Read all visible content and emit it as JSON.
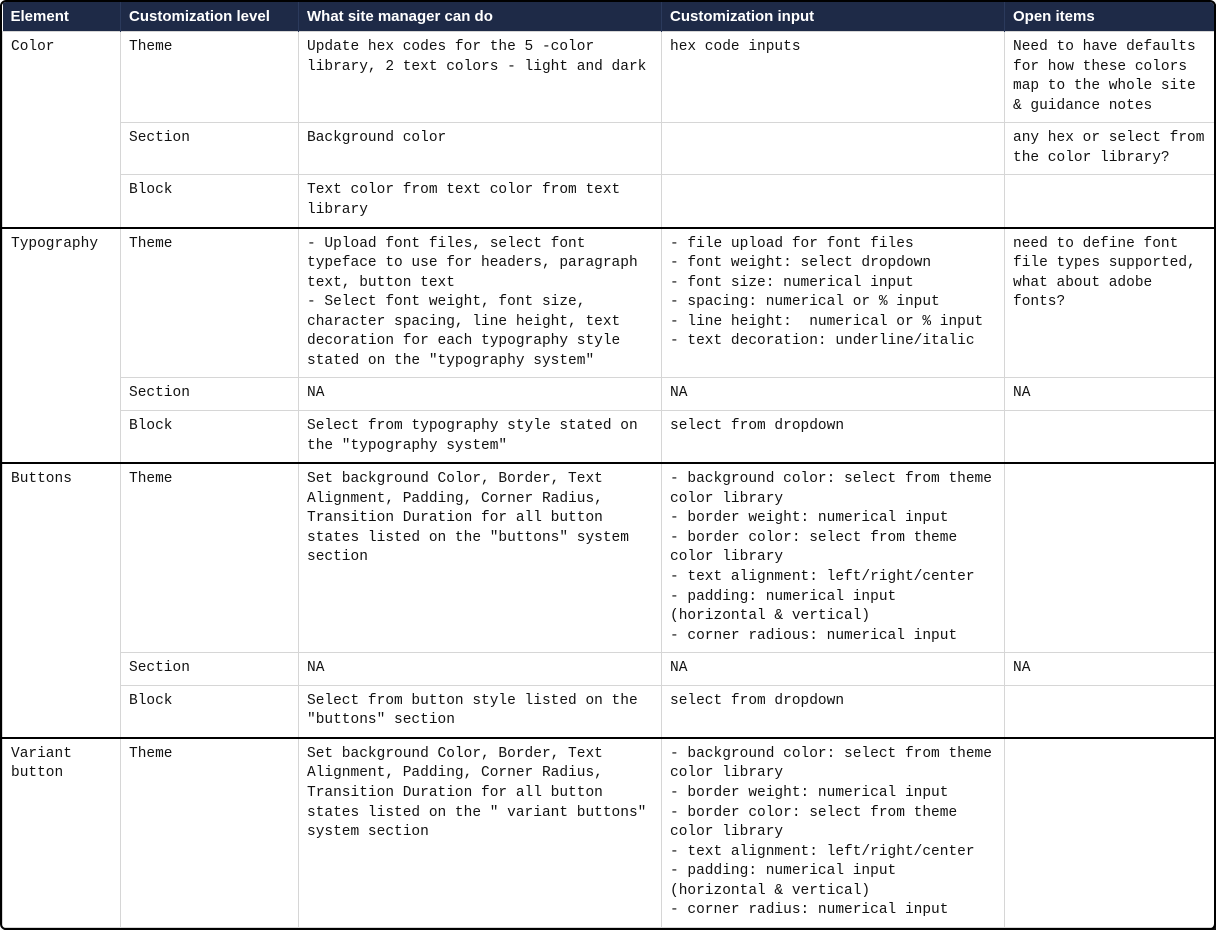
{
  "columns": [
    "Element",
    "Customization level",
    "What site manager can do",
    "Customization input",
    "Open items"
  ],
  "groups": [
    {
      "element": "Color",
      "rows": [
        {
          "level": "Theme",
          "what": "Update hex codes for the 5 -color library, 2 text colors - light and dark",
          "input": "hex code inputs",
          "open": "Need to have defaults for how these colors map to the whole site & guidance notes"
        },
        {
          "level": "Section",
          "what": "Background color",
          "input": "",
          "open": "any hex or select from the color library?"
        },
        {
          "level": "Block",
          "what": "Text color from text color from text library",
          "input": "",
          "open": ""
        }
      ]
    },
    {
      "element": "Typography",
      "rows": [
        {
          "level": "Theme",
          "what": "- Upload font files, select font typeface to use for headers, paragraph text, button text\n- Select font weight, font size, character spacing, line height, text decoration for each typography style stated on the \"typography system\"",
          "input": "- file upload for font files\n- font weight: select dropdown\n- font size: numerical input\n- spacing: numerical or % input\n- line height:  numerical or % input\n- text decoration: underline/italic",
          "open": "need to define font file types supported, what about adobe fonts?"
        },
        {
          "level": "Section",
          "what": "NA",
          "input": "NA",
          "open": "NA"
        },
        {
          "level": "Block",
          "what": "Select from typography style stated on the \"typography system\"",
          "input": "select from dropdown",
          "open": ""
        }
      ]
    },
    {
      "element": "Buttons",
      "rows": [
        {
          "level": "Theme",
          "what": "Set background Color, Border, Text Alignment, Padding, Corner Radius, Transition Duration for all button states listed on the \"buttons\" system section",
          "input": "- background color: select from theme color library\n- border weight: numerical input\n- border color: select from theme color library\n- text alignment: left/right/center\n- padding: numerical input (horizontal & vertical)\n- corner radious: numerical input",
          "open": ""
        },
        {
          "level": "Section",
          "what": "NA",
          "input": "NA",
          "open": "NA"
        },
        {
          "level": "Block",
          "what": "Select from button style listed on the \"buttons\" section",
          "input": "select from dropdown",
          "open": ""
        }
      ]
    },
    {
      "element": "Variant button",
      "rows": [
        {
          "level": "Theme",
          "what": "Set background Color, Border, Text Alignment, Padding, Corner Radius, Transition Duration for all button states listed on the \" variant buttons\" system section",
          "input": "- background color: select from theme color library\n- border weight: numerical input\n- border color: select from theme color library\n- text alignment: left/right/center\n- padding: numerical input (horizontal & vertical)\n- corner radius: numerical input",
          "open": ""
        }
      ]
    }
  ]
}
